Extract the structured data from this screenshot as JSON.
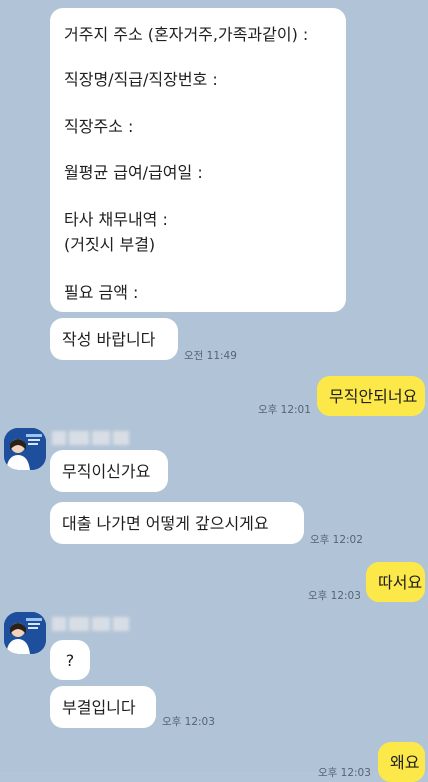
{
  "messages": {
    "form": {
      "lines": [
        "거주지 주소 (혼자거주,가족과같이) :",
        "직장명/직급/직장번호 :",
        "직장주소 :",
        "월평균 급여/급여일 :",
        "타사 채무내역 :",
        "(거짓시 부결)",
        "필요 금액 :"
      ]
    },
    "write_request": {
      "text": "작성 바랍니다",
      "time": "오전 11:49"
    },
    "unemployed_reply": {
      "text": "무직안되너요",
      "time": "오후 12:01"
    },
    "are_unemployed": {
      "text": "무직이신가요"
    },
    "how_repay": {
      "text": "대출 나가면 어떻게 갚으시게요",
      "time": "오후 12:02"
    },
    "ddaseo": {
      "text": "따서요",
      "time": "오후 12:03"
    },
    "question": {
      "text": "?"
    },
    "rejected": {
      "text": "부결입니다",
      "time": "오후 12:03"
    },
    "why": {
      "text": "왜요",
      "time": "오후 12:03"
    }
  },
  "colors": {
    "background": "#b1c4d7",
    "incoming_bubble": "#ffffff",
    "outgoing_bubble": "#fde84a"
  },
  "icons": {
    "avatar": "profile-avatar-icon"
  }
}
